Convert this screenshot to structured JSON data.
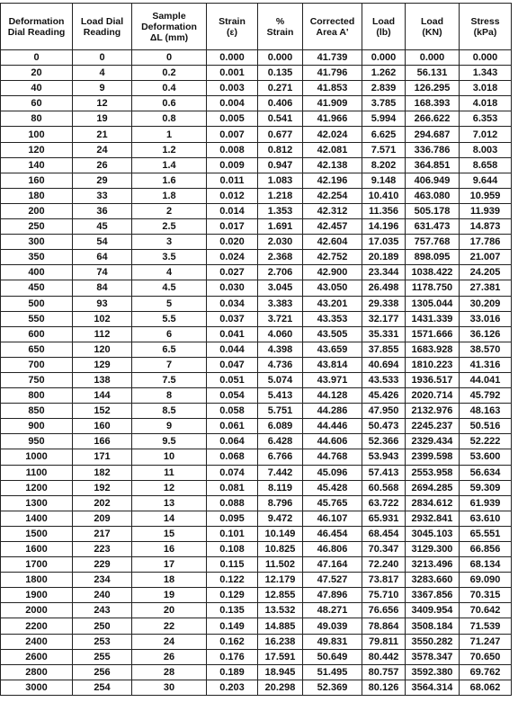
{
  "table": {
    "headers": [
      [
        "Deformation",
        "Dial Reading"
      ],
      [
        "Load Dial",
        "Reading"
      ],
      [
        "Sample",
        "Deformation",
        "ΔL (mm)"
      ],
      [
        "Strain",
        "(ε)"
      ],
      [
        "%",
        "Strain"
      ],
      [
        "Corrected",
        "Area A'"
      ],
      [
        "Load",
        "(lb)"
      ],
      [
        "Load",
        "(KN)"
      ],
      [
        "Stress",
        "(kPa)"
      ]
    ],
    "rows": [
      [
        "0",
        "0",
        "0",
        "0.000",
        "0.000",
        "41.739",
        "0.000",
        "0.000",
        "0.000"
      ],
      [
        "20",
        "4",
        "0.2",
        "0.001",
        "0.135",
        "41.796",
        "1.262",
        "56.131",
        "1.343"
      ],
      [
        "40",
        "9",
        "0.4",
        "0.003",
        "0.271",
        "41.853",
        "2.839",
        "126.295",
        "3.018"
      ],
      [
        "60",
        "12",
        "0.6",
        "0.004",
        "0.406",
        "41.909",
        "3.785",
        "168.393",
        "4.018"
      ],
      [
        "80",
        "19",
        "0.8",
        "0.005",
        "0.541",
        "41.966",
        "5.994",
        "266.622",
        "6.353"
      ],
      [
        "100",
        "21",
        "1",
        "0.007",
        "0.677",
        "42.024",
        "6.625",
        "294.687",
        "7.012"
      ],
      [
        "120",
        "24",
        "1.2",
        "0.008",
        "0.812",
        "42.081",
        "7.571",
        "336.786",
        "8.003"
      ],
      [
        "140",
        "26",
        "1.4",
        "0.009",
        "0.947",
        "42.138",
        "8.202",
        "364.851",
        "8.658"
      ],
      [
        "160",
        "29",
        "1.6",
        "0.011",
        "1.083",
        "42.196",
        "9.148",
        "406.949",
        "9.644"
      ],
      [
        "180",
        "33",
        "1.8",
        "0.012",
        "1.218",
        "42.254",
        "10.410",
        "463.080",
        "10.959"
      ],
      [
        "200",
        "36",
        "2",
        "0.014",
        "1.353",
        "42.312",
        "11.356",
        "505.178",
        "11.939"
      ],
      [
        "250",
        "45",
        "2.5",
        "0.017",
        "1.691",
        "42.457",
        "14.196",
        "631.473",
        "14.873"
      ],
      [
        "300",
        "54",
        "3",
        "0.020",
        "2.030",
        "42.604",
        "17.035",
        "757.768",
        "17.786"
      ],
      [
        "350",
        "64",
        "3.5",
        "0.024",
        "2.368",
        "42.752",
        "20.189",
        "898.095",
        "21.007"
      ],
      [
        "400",
        "74",
        "4",
        "0.027",
        "2.706",
        "42.900",
        "23.344",
        "1038.422",
        "24.205"
      ],
      [
        "450",
        "84",
        "4.5",
        "0.030",
        "3.045",
        "43.050",
        "26.498",
        "1178.750",
        "27.381"
      ],
      [
        "500",
        "93",
        "5",
        "0.034",
        "3.383",
        "43.201",
        "29.338",
        "1305.044",
        "30.209"
      ],
      [
        "550",
        "102",
        "5.5",
        "0.037",
        "3.721",
        "43.353",
        "32.177",
        "1431.339",
        "33.016"
      ],
      [
        "600",
        "112",
        "6",
        "0.041",
        "4.060",
        "43.505",
        "35.331",
        "1571.666",
        "36.126"
      ],
      [
        "650",
        "120",
        "6.5",
        "0.044",
        "4.398",
        "43.659",
        "37.855",
        "1683.928",
        "38.570"
      ],
      [
        "700",
        "129",
        "7",
        "0.047",
        "4.736",
        "43.814",
        "40.694",
        "1810.223",
        "41.316"
      ],
      [
        "750",
        "138",
        "7.5",
        "0.051",
        "5.074",
        "43.971",
        "43.533",
        "1936.517",
        "44.041"
      ],
      [
        "800",
        "144",
        "8",
        "0.054",
        "5.413",
        "44.128",
        "45.426",
        "2020.714",
        "45.792"
      ],
      [
        "850",
        "152",
        "8.5",
        "0.058",
        "5.751",
        "44.286",
        "47.950",
        "2132.976",
        "48.163"
      ],
      [
        "900",
        "160",
        "9",
        "0.061",
        "6.089",
        "44.446",
        "50.473",
        "2245.237",
        "50.516"
      ],
      [
        "950",
        "166",
        "9.5",
        "0.064",
        "6.428",
        "44.606",
        "52.366",
        "2329.434",
        "52.222"
      ],
      [
        "1000",
        "171",
        "10",
        "0.068",
        "6.766",
        "44.768",
        "53.943",
        "2399.598",
        "53.600"
      ],
      [
        "1100",
        "182",
        "11",
        "0.074",
        "7.442",
        "45.096",
        "57.413",
        "2553.958",
        "56.634"
      ],
      [
        "1200",
        "192",
        "12",
        "0.081",
        "8.119",
        "45.428",
        "60.568",
        "2694.285",
        "59.309"
      ],
      [
        "1300",
        "202",
        "13",
        "0.088",
        "8.796",
        "45.765",
        "63.722",
        "2834.612",
        "61.939"
      ],
      [
        "1400",
        "209",
        "14",
        "0.095",
        "9.472",
        "46.107",
        "65.931",
        "2932.841",
        "63.610"
      ],
      [
        "1500",
        "217",
        "15",
        "0.101",
        "10.149",
        "46.454",
        "68.454",
        "3045.103",
        "65.551"
      ],
      [
        "1600",
        "223",
        "16",
        "0.108",
        "10.825",
        "46.806",
        "70.347",
        "3129.300",
        "66.856"
      ],
      [
        "1700",
        "229",
        "17",
        "0.115",
        "11.502",
        "47.164",
        "72.240",
        "3213.496",
        "68.134"
      ],
      [
        "1800",
        "234",
        "18",
        "0.122",
        "12.179",
        "47.527",
        "73.817",
        "3283.660",
        "69.090"
      ],
      [
        "1900",
        "240",
        "19",
        "0.129",
        "12.855",
        "47.896",
        "75.710",
        "3367.856",
        "70.315"
      ],
      [
        "2000",
        "243",
        "20",
        "0.135",
        "13.532",
        "48.271",
        "76.656",
        "3409.954",
        "70.642"
      ],
      [
        "2200",
        "250",
        "22",
        "0.149",
        "14.885",
        "49.039",
        "78.864",
        "3508.184",
        "71.539"
      ],
      [
        "2400",
        "253",
        "24",
        "0.162",
        "16.238",
        "49.831",
        "79.811",
        "3550.282",
        "71.247"
      ],
      [
        "2600",
        "255",
        "26",
        "0.176",
        "17.591",
        "50.649",
        "80.442",
        "3578.347",
        "70.650"
      ],
      [
        "2800",
        "256",
        "28",
        "0.189",
        "18.945",
        "51.495",
        "80.757",
        "3592.380",
        "69.762"
      ],
      [
        "3000",
        "254",
        "30",
        "0.203",
        "20.298",
        "52.369",
        "80.126",
        "3564.314",
        "68.062"
      ]
    ]
  }
}
